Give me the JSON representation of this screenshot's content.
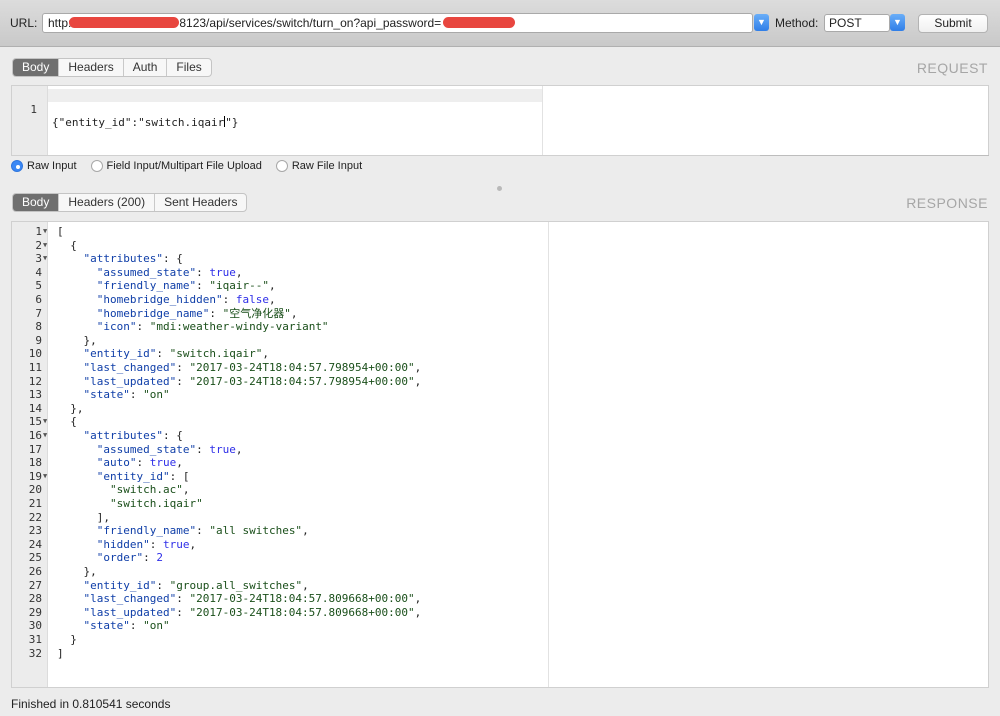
{
  "toolbar": {
    "url_label": "URL:",
    "url_prefix": "http:",
    "url_middle": "8123/api/services/switch/turn_on?api_password=",
    "method_label": "Method:",
    "method_value": "POST",
    "submit_label": "Submit"
  },
  "request": {
    "title": "REQUEST",
    "tabs": [
      "Body",
      "Headers",
      "Auth",
      "Files"
    ],
    "body_line": "{\"entity_id\":\"switch.iqair",
    "body_line_tail": "\"}",
    "line_number": "1",
    "input_modes": [
      "Raw Input",
      "Field Input/Multipart File Upload",
      "Raw File Input"
    ]
  },
  "response": {
    "title": "RESPONSE",
    "tabs": [
      "Body",
      "Headers (200)",
      "Sent Headers"
    ],
    "line_numbers": [
      "1",
      "2",
      "3",
      "4",
      "5",
      "6",
      "7",
      "8",
      "9",
      "10",
      "11",
      "12",
      "13",
      "14",
      "15",
      "16",
      "17",
      "18",
      "19",
      "20",
      "21",
      "22",
      "23",
      "24",
      "25",
      "26",
      "27",
      "28",
      "29",
      "30",
      "31",
      "32"
    ],
    "values": {
      "l4": "true",
      "l5": "\"iqair--\"",
      "l6": "false",
      "l7": "\"空气净化器\"",
      "l8": "\"mdi:weather-windy-variant\"",
      "l11": "\"switch.iqair\"",
      "l12": "\"2017-03-24T18:04:57.798954+00:00\"",
      "l13": "\"2017-03-24T18:04:57.798954+00:00\"",
      "l14": "\"on\"",
      "l18": "true",
      "l19": "true",
      "l21": "\"switch.ac\"",
      "l22": "\"switch.iqair\"",
      "l24": "\"all switches\"",
      "l25": "true",
      "l26": "2",
      "l28": "\"group.all_switches\"",
      "l29": "\"2017-03-24T18:04:57.809668+00:00\"",
      "l30": "\"2017-03-24T18:04:57.809668+00:00\"",
      "l31": "\"on\""
    },
    "keys": {
      "attributes": "\"attributes\"",
      "assumed_state": "\"assumed_state\"",
      "friendly_name": "\"friendly_name\"",
      "homebridge_hidden": "\"homebridge_hidden\"",
      "homebridge_name": "\"homebridge_name\"",
      "icon": "\"icon\"",
      "entity_id": "\"entity_id\"",
      "last_changed": "\"last_changed\"",
      "last_updated": "\"last_updated\"",
      "state": "\"state\"",
      "auto": "\"auto\"",
      "hidden": "\"hidden\"",
      "order": "\"order\""
    }
  },
  "status": "Finished in 0.810541 seconds"
}
